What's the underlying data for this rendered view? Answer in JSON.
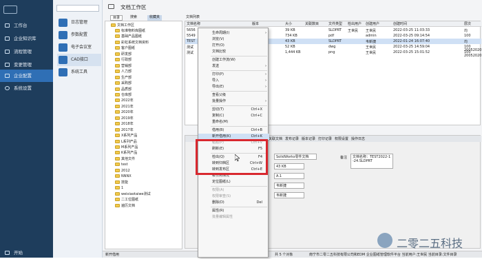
{
  "sidebar": {
    "items": [
      {
        "label": "工作台"
      },
      {
        "label": "企业知识库"
      },
      {
        "label": "流程管理"
      },
      {
        "label": "变更管理"
      },
      {
        "label": "企业配置"
      },
      {
        "label": "系统设置"
      }
    ],
    "start": "开始"
  },
  "modules": [
    "日志管理",
    "参数配置",
    "电子会议室",
    "CAD接口",
    "系统工具"
  ],
  "window": {
    "title": "文档工作区"
  },
  "tabs": [
    "目录",
    "搜索",
    "收藏夹"
  ],
  "tree": {
    "root": "文档工作区",
    "items": [
      "标准物料库图纸",
      "基础产品图纸",
      "彩虹系统文档资料",
      "客户图纸",
      "研发部",
      "行政部",
      "营销部",
      "人力部",
      "生产部",
      "采购部",
      "品质部",
      "仓库部",
      "2022年",
      "2021年",
      "2020年",
      "2019年",
      "2018年",
      "2017年",
      "X系列产品",
      "L系列产品",
      "M系列产品",
      "K系列产品",
      "其他文件",
      "test",
      "2012",
      "NNNX",
      "技能",
      "1",
      "weixiaotaiwe测试",
      "二工位图纸",
      "遍历文档"
    ]
  },
  "file_list": {
    "title": "文档列表",
    "headers": [
      "文档名称",
      "版本",
      "大小",
      "关联数目",
      "文件类型",
      "检出用户",
      "创建用户",
      "创建时间",
      "层次"
    ],
    "rows": [
      [
        "5656",
        "",
        "39 KB",
        "",
        "SLDPRT",
        "王世民",
        "王世民",
        "2022-03-25 11:03:33",
        "均"
      ],
      [
        "5549",
        "",
        "734 KB",
        "",
        "pdf",
        "",
        "admin",
        "2022-03-25 09:14:54",
        "100"
      ],
      [
        "TEST",
        "",
        "43 KB",
        "",
        "SLDPRT",
        "",
        "韦新捷",
        "2022-01-24 16:07:40",
        "均"
      ],
      [
        "测试",
        "",
        "52 KB",
        "",
        "dwg",
        "",
        "王世民",
        "2022-03-25 14:59:04",
        "100"
      ],
      [
        "测试",
        "",
        "1,444 KB",
        "",
        "png",
        "",
        "王世民",
        "2022-03-25 15:01:52",
        "100"
      ]
    ],
    "extra": [
      "20052020",
      "20052020"
    ]
  },
  "props": {
    "tabs": [
      "关联文档",
      "发布记录",
      "版本记录",
      "打印记录",
      "权限设置",
      "操作日志"
    ],
    "file_label": "SolidWorks零件文档",
    "size": "43 KB",
    "ver": "A.1",
    "user1": "韦新捷",
    "user2": "韦新捷",
    "remark_label": "备注",
    "remark": "文档名称：TEST2022-1-24.SLDPRT"
  },
  "context_menu": [
    {
      "label": "生命周期(I)",
      "arrow": true
    },
    {
      "label": "浏览(V)"
    },
    {
      "label": "打开(O)"
    },
    {
      "label": "文档比较"
    },
    {
      "sep": true
    },
    {
      "label": "创建工作流(W)"
    },
    {
      "label": "发送",
      "arrow": true
    },
    {
      "sep": true
    },
    {
      "label": "打印(P)",
      "arrow": true
    },
    {
      "label": "导入",
      "arrow": true
    },
    {
      "label": "导出(E)",
      "arrow": true
    },
    {
      "sep": true
    },
    {
      "label": "查看父级"
    },
    {
      "label": "批量操作",
      "arrow": true
    },
    {
      "sep": true
    },
    {
      "label": "剪切(T)",
      "sc": "Ctrl+X"
    },
    {
      "label": "复制(C)",
      "sc": "Ctrl+C"
    },
    {
      "label": "重命名(M)"
    },
    {
      "sep": true
    },
    {
      "label": "借用(B)",
      "sc": "Ctrl+B"
    },
    {
      "label": "新开借用(K)",
      "sc": "Ctrl+K"
    },
    {
      "label": "粘贴(P)",
      "sc": "Ctrl+V",
      "dis": true
    },
    {
      "label": "刷新(E)",
      "sc": "F5"
    },
    {
      "sep": true
    },
    {
      "label": "检出(Q)",
      "sc": "F4"
    },
    {
      "label": "转到归档区",
      "sc": "Ctrl+W"
    },
    {
      "label": "转到发布区",
      "sc": "Ctrl+E"
    },
    {
      "label": "被引用情况"
    },
    {
      "label": "定位图纸(L)"
    },
    {
      "sep": true
    },
    {
      "label": "权限(A)",
      "dis": true
    },
    {
      "label": "权限审查(S)",
      "dis": true
    },
    {
      "label": "删除(D)",
      "sc": "Del"
    },
    {
      "sep": true
    },
    {
      "label": "属性(R)"
    },
    {
      "label": "批量编辑属性",
      "dis": true
    }
  ],
  "status": {
    "left": "新开借用",
    "mid": "共 5 个对象",
    "right": "南宁市二零二五科技有限公司和EDM 企业图纸管理软件平台   当前用户:王世民   当前目录:文件目录"
  },
  "watermark": "二零二五科技",
  "colors": {
    "sidebar": "#1e3d5c",
    "accent": "#2f6fb5",
    "highlight": "#d9282f"
  }
}
